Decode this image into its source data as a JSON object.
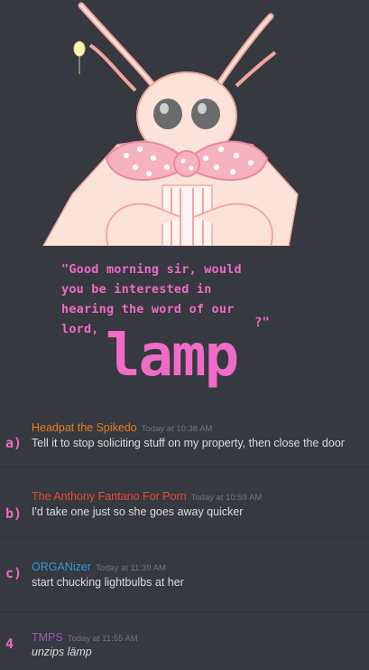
{
  "image": {
    "speech_text": [
      "\"Good morning sir, would",
      "you be interested in",
      "hearing the word of our",
      "lord,"
    ],
    "big_word": "lamp",
    "speech_end": "?\"",
    "colors": {
      "speech": "#f06ac8",
      "background": "#36393f"
    }
  },
  "messages": [
    {
      "marker": "a)",
      "username": "Headpat the Spikedo",
      "color": "#e67e22",
      "timestamp": "Today at 10:38 AM",
      "text": "Tell it to stop soliciting stuff on my property, then close the door"
    },
    {
      "marker": "b)",
      "username": "The Anthony Fantano For Porn",
      "color": "#e74c3c",
      "timestamp": "Today at 10:59 AM",
      "text": "I'd take one just so she goes away quicker"
    },
    {
      "marker": "c)",
      "username": "ORGANizer",
      "color": "#3498db",
      "timestamp": "Today at 11:39 AM",
      "text": "start chucking lightbulbs at her"
    },
    {
      "marker": "4",
      "username": "TMPS",
      "color": "#9b59b6",
      "timestamp": "Today at 11:55 AM",
      "text": "unzips lämp"
    }
  ]
}
